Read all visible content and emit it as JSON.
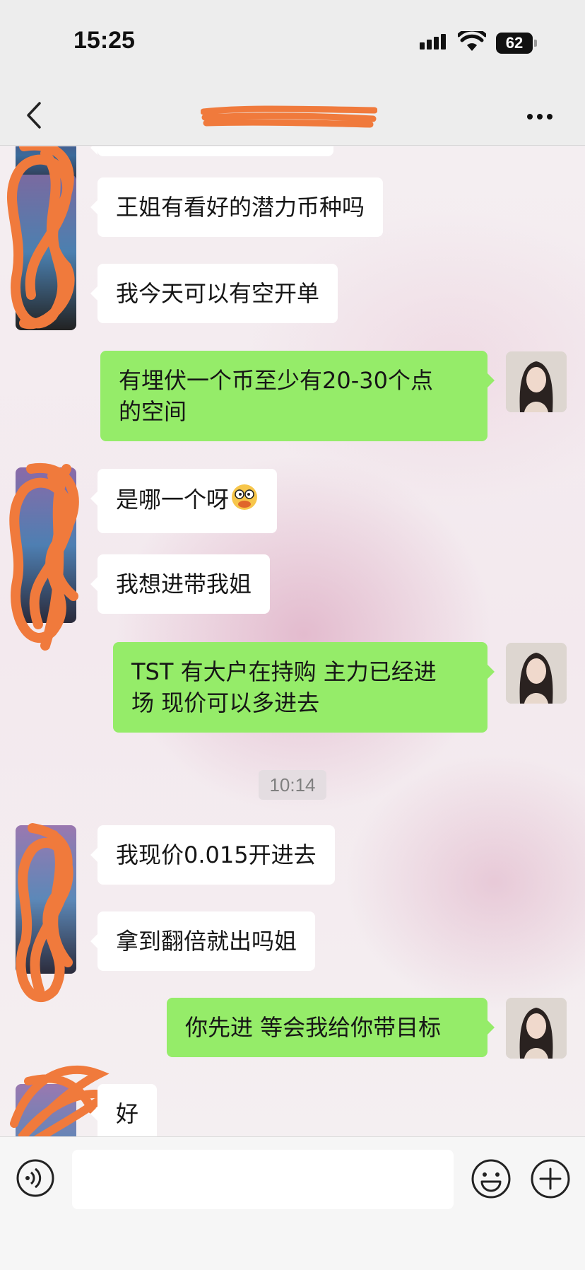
{
  "status_bar": {
    "time": "15:25",
    "battery": "62"
  },
  "nav": {
    "back_icon": "chevron-left-icon",
    "more_icon": "more-dots-icon"
  },
  "messages": [
    {
      "side": "left",
      "text": "王姐有看好的潜力币种吗"
    },
    {
      "side": "left",
      "text": "我今天可以有空开单"
    },
    {
      "side": "right",
      "text_line1": "有埋伏一个币至少有20-30个点",
      "text_line2": "的空间"
    },
    {
      "side": "left",
      "text": "是哪一个呀",
      "emoji": "pondering-face"
    },
    {
      "side": "left",
      "text": "我想进带我姐"
    },
    {
      "side": "right",
      "text_line1": "TST 有大户在持购 主力已经进",
      "text_line2": "场 现价可以多进去"
    },
    {
      "side": "left",
      "text": "我现价0.015开进去"
    },
    {
      "side": "left",
      "text": "拿到翻倍就出吗姐"
    },
    {
      "side": "right",
      "text": "你先进 等会我给你带目标"
    },
    {
      "side": "left",
      "text": "好"
    }
  ],
  "timestamp": "10:14",
  "input_bar": {
    "voice_icon": "voice-icon",
    "emoji_icon": "emoji-icon",
    "plus_icon": "plus-icon",
    "input_value": ""
  },
  "colors": {
    "my_bubble": "#95ec69",
    "their_bubble": "#ffffff",
    "redaction": "#f07a3c"
  }
}
